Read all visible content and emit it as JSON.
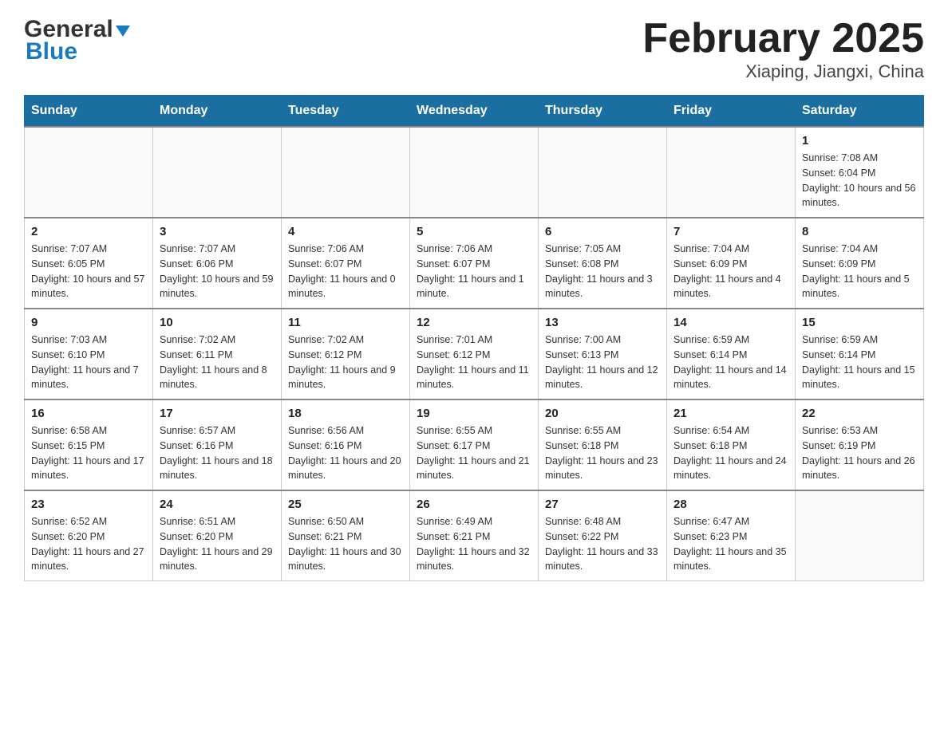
{
  "logo": {
    "line1": "General",
    "line2": "Blue"
  },
  "title": "February 2025",
  "subtitle": "Xiaping, Jiangxi, China",
  "days_of_week": [
    "Sunday",
    "Monday",
    "Tuesday",
    "Wednesday",
    "Thursday",
    "Friday",
    "Saturday"
  ],
  "weeks": [
    [
      {
        "day": "",
        "sunrise": "",
        "sunset": "",
        "daylight": ""
      },
      {
        "day": "",
        "sunrise": "",
        "sunset": "",
        "daylight": ""
      },
      {
        "day": "",
        "sunrise": "",
        "sunset": "",
        "daylight": ""
      },
      {
        "day": "",
        "sunrise": "",
        "sunset": "",
        "daylight": ""
      },
      {
        "day": "",
        "sunrise": "",
        "sunset": "",
        "daylight": ""
      },
      {
        "day": "",
        "sunrise": "",
        "sunset": "",
        "daylight": ""
      },
      {
        "day": "1",
        "sunrise": "Sunrise: 7:08 AM",
        "sunset": "Sunset: 6:04 PM",
        "daylight": "Daylight: 10 hours and 56 minutes."
      }
    ],
    [
      {
        "day": "2",
        "sunrise": "Sunrise: 7:07 AM",
        "sunset": "Sunset: 6:05 PM",
        "daylight": "Daylight: 10 hours and 57 minutes."
      },
      {
        "day": "3",
        "sunrise": "Sunrise: 7:07 AM",
        "sunset": "Sunset: 6:06 PM",
        "daylight": "Daylight: 10 hours and 59 minutes."
      },
      {
        "day": "4",
        "sunrise": "Sunrise: 7:06 AM",
        "sunset": "Sunset: 6:07 PM",
        "daylight": "Daylight: 11 hours and 0 minutes."
      },
      {
        "day": "5",
        "sunrise": "Sunrise: 7:06 AM",
        "sunset": "Sunset: 6:07 PM",
        "daylight": "Daylight: 11 hours and 1 minute."
      },
      {
        "day": "6",
        "sunrise": "Sunrise: 7:05 AM",
        "sunset": "Sunset: 6:08 PM",
        "daylight": "Daylight: 11 hours and 3 minutes."
      },
      {
        "day": "7",
        "sunrise": "Sunrise: 7:04 AM",
        "sunset": "Sunset: 6:09 PM",
        "daylight": "Daylight: 11 hours and 4 minutes."
      },
      {
        "day": "8",
        "sunrise": "Sunrise: 7:04 AM",
        "sunset": "Sunset: 6:09 PM",
        "daylight": "Daylight: 11 hours and 5 minutes."
      }
    ],
    [
      {
        "day": "9",
        "sunrise": "Sunrise: 7:03 AM",
        "sunset": "Sunset: 6:10 PM",
        "daylight": "Daylight: 11 hours and 7 minutes."
      },
      {
        "day": "10",
        "sunrise": "Sunrise: 7:02 AM",
        "sunset": "Sunset: 6:11 PM",
        "daylight": "Daylight: 11 hours and 8 minutes."
      },
      {
        "day": "11",
        "sunrise": "Sunrise: 7:02 AM",
        "sunset": "Sunset: 6:12 PM",
        "daylight": "Daylight: 11 hours and 9 minutes."
      },
      {
        "day": "12",
        "sunrise": "Sunrise: 7:01 AM",
        "sunset": "Sunset: 6:12 PM",
        "daylight": "Daylight: 11 hours and 11 minutes."
      },
      {
        "day": "13",
        "sunrise": "Sunrise: 7:00 AM",
        "sunset": "Sunset: 6:13 PM",
        "daylight": "Daylight: 11 hours and 12 minutes."
      },
      {
        "day": "14",
        "sunrise": "Sunrise: 6:59 AM",
        "sunset": "Sunset: 6:14 PM",
        "daylight": "Daylight: 11 hours and 14 minutes."
      },
      {
        "day": "15",
        "sunrise": "Sunrise: 6:59 AM",
        "sunset": "Sunset: 6:14 PM",
        "daylight": "Daylight: 11 hours and 15 minutes."
      }
    ],
    [
      {
        "day": "16",
        "sunrise": "Sunrise: 6:58 AM",
        "sunset": "Sunset: 6:15 PM",
        "daylight": "Daylight: 11 hours and 17 minutes."
      },
      {
        "day": "17",
        "sunrise": "Sunrise: 6:57 AM",
        "sunset": "Sunset: 6:16 PM",
        "daylight": "Daylight: 11 hours and 18 minutes."
      },
      {
        "day": "18",
        "sunrise": "Sunrise: 6:56 AM",
        "sunset": "Sunset: 6:16 PM",
        "daylight": "Daylight: 11 hours and 20 minutes."
      },
      {
        "day": "19",
        "sunrise": "Sunrise: 6:55 AM",
        "sunset": "Sunset: 6:17 PM",
        "daylight": "Daylight: 11 hours and 21 minutes."
      },
      {
        "day": "20",
        "sunrise": "Sunrise: 6:55 AM",
        "sunset": "Sunset: 6:18 PM",
        "daylight": "Daylight: 11 hours and 23 minutes."
      },
      {
        "day": "21",
        "sunrise": "Sunrise: 6:54 AM",
        "sunset": "Sunset: 6:18 PM",
        "daylight": "Daylight: 11 hours and 24 minutes."
      },
      {
        "day": "22",
        "sunrise": "Sunrise: 6:53 AM",
        "sunset": "Sunset: 6:19 PM",
        "daylight": "Daylight: 11 hours and 26 minutes."
      }
    ],
    [
      {
        "day": "23",
        "sunrise": "Sunrise: 6:52 AM",
        "sunset": "Sunset: 6:20 PM",
        "daylight": "Daylight: 11 hours and 27 minutes."
      },
      {
        "day": "24",
        "sunrise": "Sunrise: 6:51 AM",
        "sunset": "Sunset: 6:20 PM",
        "daylight": "Daylight: 11 hours and 29 minutes."
      },
      {
        "day": "25",
        "sunrise": "Sunrise: 6:50 AM",
        "sunset": "Sunset: 6:21 PM",
        "daylight": "Daylight: 11 hours and 30 minutes."
      },
      {
        "day": "26",
        "sunrise": "Sunrise: 6:49 AM",
        "sunset": "Sunset: 6:21 PM",
        "daylight": "Daylight: 11 hours and 32 minutes."
      },
      {
        "day": "27",
        "sunrise": "Sunrise: 6:48 AM",
        "sunset": "Sunset: 6:22 PM",
        "daylight": "Daylight: 11 hours and 33 minutes."
      },
      {
        "day": "28",
        "sunrise": "Sunrise: 6:47 AM",
        "sunset": "Sunset: 6:23 PM",
        "daylight": "Daylight: 11 hours and 35 minutes."
      },
      {
        "day": "",
        "sunrise": "",
        "sunset": "",
        "daylight": ""
      }
    ]
  ]
}
